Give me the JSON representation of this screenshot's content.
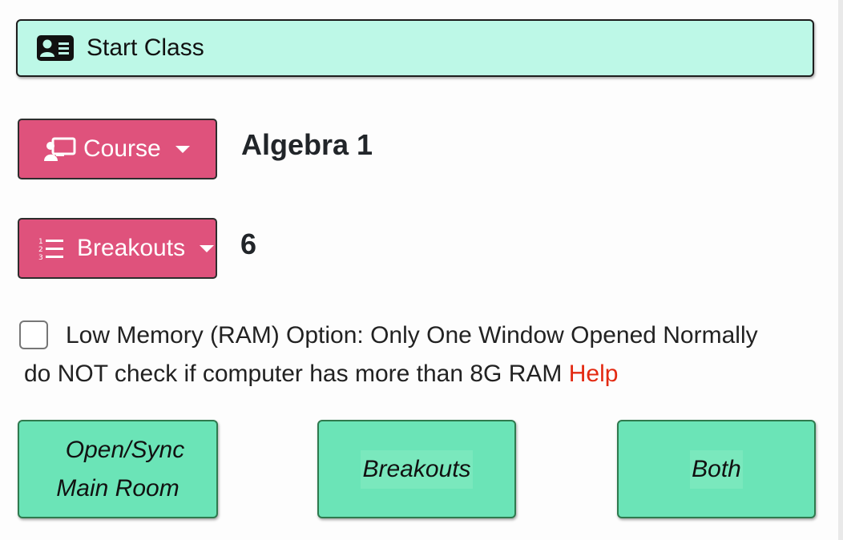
{
  "start_class": {
    "label": "Start Class",
    "icon": "id-card-icon",
    "background": "#bdf8e7"
  },
  "course": {
    "button_label": "Course",
    "icon": "chalkboard-teacher-icon",
    "value": "Algebra 1",
    "color": "#df527c"
  },
  "breakouts": {
    "button_label": "Breakouts",
    "icon": "list-ol-icon",
    "value": "6",
    "color": "#df527c"
  },
  "low_memory": {
    "checked": false,
    "line1": "Low Memory (RAM) Option: Only One Window Opened Normally",
    "line2": "do NOT check if computer has more than 8G RAM",
    "help_label": "Help",
    "help_color": "#e32a12"
  },
  "actions": {
    "open_sync_line1": "Open/Sync",
    "open_sync_line2": "Main Room",
    "breakouts_label": "Breakouts",
    "both_label": "Both",
    "color": "#6be4b7"
  }
}
